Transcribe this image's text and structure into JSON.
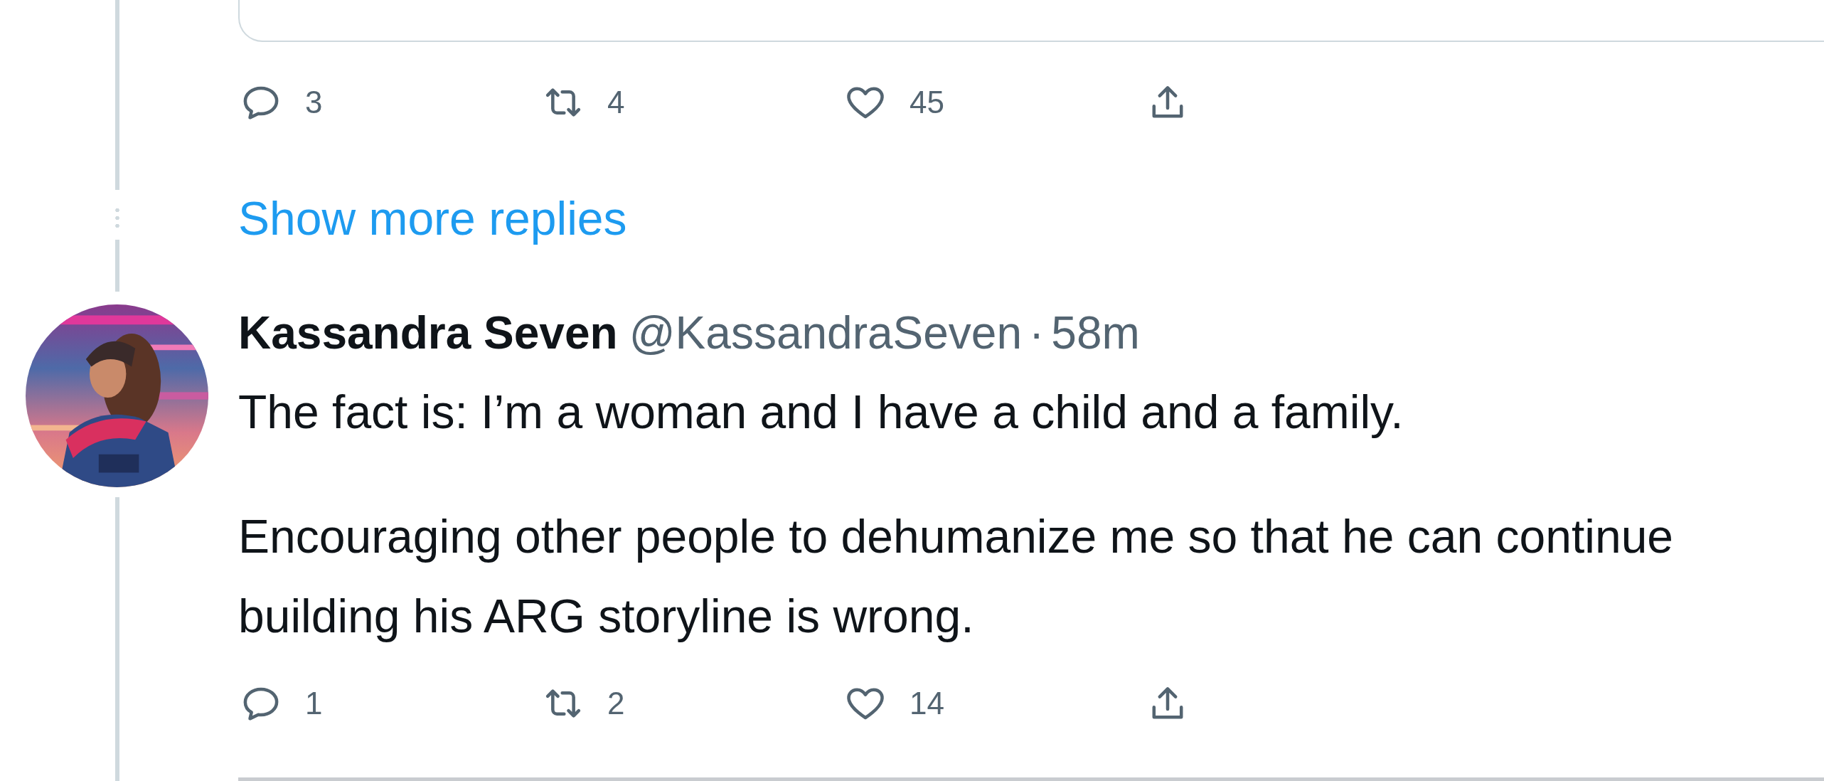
{
  "previous_tweet": {
    "actions": [
      {
        "kind": "reply",
        "count": "3"
      },
      {
        "kind": "retweet",
        "count": "4"
      },
      {
        "kind": "like",
        "count": "45"
      },
      {
        "kind": "share"
      }
    ]
  },
  "show_more_replies": "Show more replies",
  "tweet": {
    "name": "Kassandra Seven",
    "handle": "@KassandraSeven",
    "separator": "·",
    "time": "58m",
    "paragraphs": [
      "The fact is: I’m a woman and I have a child and a family.",
      "Encouraging other people to dehumanize me so that he can continue building his ARG storyline is wrong."
    ],
    "actions": [
      {
        "kind": "reply",
        "count": "1"
      },
      {
        "kind": "retweet",
        "count": "2"
      },
      {
        "kind": "like",
        "count": "14"
      },
      {
        "kind": "share"
      }
    ]
  }
}
